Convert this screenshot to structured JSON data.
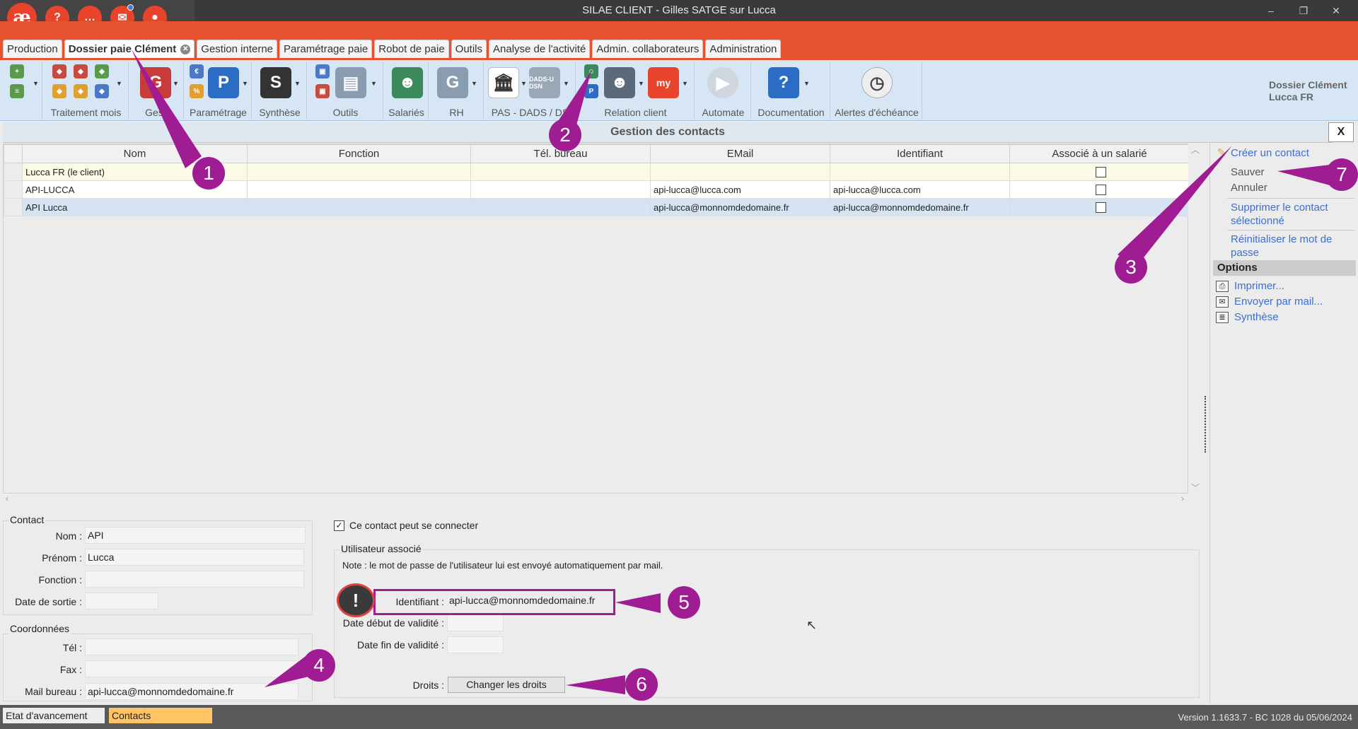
{
  "window": {
    "title": "SILAE CLIENT - Gilles SATGE sur Lucca",
    "logo": "æ"
  },
  "hub_buttons": [
    {
      "icon": "help-icon",
      "glyph": "?"
    },
    {
      "icon": "chat-icon",
      "glyph": "…"
    },
    {
      "icon": "mail-icon",
      "glyph": "✉"
    },
    {
      "icon": "user-icon",
      "glyph": "●"
    }
  ],
  "tabs": [
    {
      "label": "Production"
    },
    {
      "label": "Dossier paie Clément",
      "active": true
    },
    {
      "label": "Gestion interne"
    },
    {
      "label": "Paramétrage paie"
    },
    {
      "label": "Robot de paie"
    },
    {
      "label": "Outils"
    },
    {
      "label": "Analyse de l'activité"
    },
    {
      "label": "Admin. collaborateurs"
    },
    {
      "label": "Administration"
    }
  ],
  "ribbon_groups": [
    {
      "label": ""
    },
    {
      "label": "Traitement mois"
    },
    {
      "label": "Gesti"
    },
    {
      "label": "Paramétrage"
    },
    {
      "label": "Synthèse"
    },
    {
      "label": "Outils"
    },
    {
      "label": "Salariés"
    },
    {
      "label": "RH"
    },
    {
      "label": "PAS - DADS / DS"
    },
    {
      "label": "Relation client"
    },
    {
      "label": "Automate"
    },
    {
      "label": "Documentation"
    },
    {
      "label": "Alertes d'échéance"
    }
  ],
  "ribbon_icon_text": {
    "dads": "DADS-U DSN",
    "myae": "my"
  },
  "dossier": {
    "line1": "Dossier Clément",
    "line2": "Lucca FR"
  },
  "section": {
    "title": "Gestion des contacts",
    "close": "X"
  },
  "grid": {
    "columns": [
      "Nom",
      "Fonction",
      "Tél. bureau",
      "EMail",
      "Identifiant",
      "Associé à un salarié"
    ],
    "rows": [
      {
        "nom": "Lucca FR (le client)",
        "fonction": "",
        "tel": "",
        "email": "",
        "identifiant": ""
      },
      {
        "nom": "API-LUCCA",
        "fonction": "",
        "tel": "",
        "email": "api-lucca@lucca.com",
        "identifiant": "api-lucca@lucca.com"
      },
      {
        "nom": "API Lucca",
        "fonction": "",
        "tel": "",
        "email": "api-lucca@monnomdedomaine.fr",
        "identifiant": "api-lucca@monnomdedomaine.fr"
      }
    ]
  },
  "right_panel": {
    "create": "Créer un contact",
    "save": "Sauver",
    "cancel": "Annuler",
    "delete": "Supprimer le contact sélectionné",
    "reset_pwd": "Réinitialiser le mot de passe",
    "options_header": "Options",
    "print": "Imprimer...",
    "send_mail": "Envoyer par mail...",
    "synthesis": "Synthèse"
  },
  "contact_form": {
    "legend": "Contact",
    "nom_label": "Nom :",
    "nom_value": "API",
    "prenom_label": "Prénom :",
    "prenom_value": "Lucca",
    "fonction_label": "Fonction :",
    "fonction_value": "",
    "sortie_label": "Date de sortie :",
    "sortie_value": ""
  },
  "coord_form": {
    "legend": "Coordonnées",
    "tel_label": "Tél :",
    "tel_value": "",
    "fax_label": "Fax :",
    "fax_value": "",
    "mail_label": "Mail bureau :",
    "mail_value": "api-lucca@monnomdedomaine.fr"
  },
  "user_form": {
    "can_login_label": "Ce contact peut se connecter",
    "can_login": true,
    "legend": "Utilisateur associé",
    "note": "Note : le mot de passe de l'utilisateur lui est envoyé automatiquement par mail.",
    "ident_label": "Identifiant :",
    "ident_value": "api-lucca@monnomdedomaine.fr",
    "debut_label": "Date début de validité :",
    "debut_value": "",
    "fin_label": "Date fin de validité :",
    "fin_value": "",
    "droits_label": "Droits :",
    "droits_button": "Changer les droits",
    "warning_glyph": "!"
  },
  "statusbar": {
    "tab1": "Etat d'avancement",
    "tab2": "Contacts",
    "version": "Version 1.1633.7 - BC 1028 du 05/06/2024"
  },
  "annotations": [
    "1",
    "2",
    "3",
    "4",
    "5",
    "6",
    "7"
  ],
  "colors": {
    "accent": "#e8532f",
    "callout": "#a01c93",
    "link": "#3b6fd1",
    "selected_row": "#d5e3f3",
    "status_tab": "#ffc466"
  }
}
